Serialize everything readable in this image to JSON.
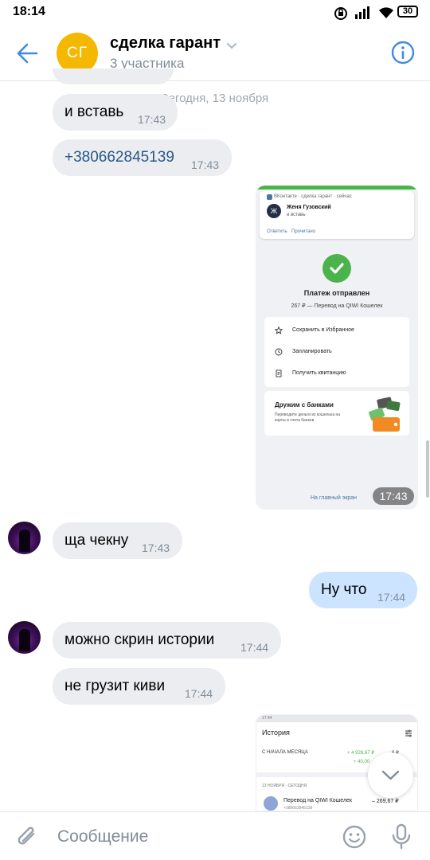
{
  "status_bar": {
    "time": "18:14",
    "battery": "30",
    "icons": [
      "alarm-icon",
      "signal-icon",
      "wifi-icon",
      "battery-icon"
    ]
  },
  "header": {
    "avatar_initials": "СГ",
    "title": "сделка гарант",
    "subtitle": "3 участника",
    "accent_color": "#3f8ae0",
    "avatar_color": "#f5b800"
  },
  "date_chip": "Сегодня, 13 ноября",
  "messages": [
    {
      "text": "и вставь",
      "time": "17:43",
      "direction": "in"
    },
    {
      "text": "+380662845139",
      "time": "17:43",
      "direction": "in",
      "is_link": true
    },
    {
      "type": "image",
      "time": "17:43",
      "direction": "out"
    },
    {
      "text": "ща чекну",
      "time": "17:43",
      "direction": "in"
    },
    {
      "text": "Ну что",
      "time": "17:44",
      "direction": "out"
    },
    {
      "text": "можно скрин истории",
      "time": "17:44",
      "direction": "in"
    },
    {
      "text": "не грузит киви",
      "time": "17:44",
      "direction": "in"
    }
  ],
  "screenshot1": {
    "notification": {
      "app_line": "ВКонтакте · сделка гарант · сейчас",
      "avatar_letter": "Ж",
      "sender": "Женя Гузовский",
      "text": "и вставь",
      "reply": "Ответить",
      "mark_read": "Прочитано"
    },
    "payment_title": "Платеж отправлен",
    "payment_subtitle": "267 ₽ — Перевод на QIWI Кошелек",
    "actions": [
      "Сохранить в Избранное",
      "Запланировать",
      "Получить квитанцию"
    ],
    "banks_title": "Дружим с банками",
    "banks_text": "Переводите деньги из кошелька на карты и счета банков",
    "home_link": "На главный экран"
  },
  "screenshot2": {
    "statusbar_time": "17:44",
    "title": "История",
    "month_label": "С НАЧАЛА МЕСЯЦА",
    "income": "+ 4 928,67 ₽",
    "income2": "+ 40,00",
    "outcome": "6 ₽",
    "date_label": "13 НОЯБРЯ · СЕГОДНЯ",
    "item_title": "Перевод на QIWI Кошелек",
    "item_sub": "+380662845139",
    "item_amount": "– 269,67 ₽"
  },
  "composer": {
    "placeholder": "Сообщение"
  }
}
